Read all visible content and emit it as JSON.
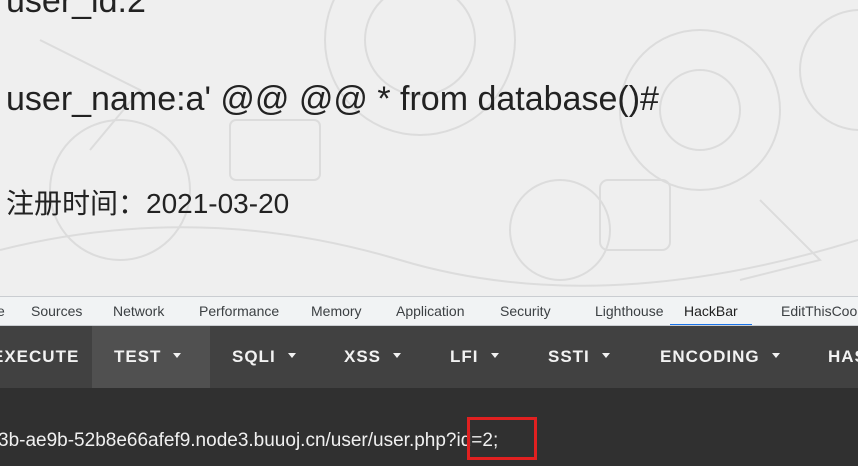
{
  "page": {
    "user_id_line": "user_id:2",
    "user_name_line": "user_name:a' @@ @@ * from database()#",
    "register_time_line": "注册时间：2021-03-20"
  },
  "devtools": {
    "tabs": [
      {
        "label": "e",
        "active": false
      },
      {
        "label": "Sources",
        "active": false
      },
      {
        "label": "Network",
        "active": false
      },
      {
        "label": "Performance",
        "active": false
      },
      {
        "label": "Memory",
        "active": false
      },
      {
        "label": "Application",
        "active": false
      },
      {
        "label": "Security",
        "active": false
      },
      {
        "label": "Lighthouse",
        "active": false
      },
      {
        "label": "HackBar",
        "active": true
      },
      {
        "label": "EditThisCookie",
        "active": false
      }
    ]
  },
  "hackbar": {
    "buttons": [
      {
        "label": "EXECUTE",
        "dropdown": false,
        "active": false
      },
      {
        "label": "TEST",
        "dropdown": true,
        "active": true
      },
      {
        "label": "SQLI",
        "dropdown": true,
        "active": false
      },
      {
        "label": "XSS",
        "dropdown": true,
        "active": false
      },
      {
        "label": "LFI",
        "dropdown": true,
        "active": false
      },
      {
        "label": "SSTI",
        "dropdown": true,
        "active": false
      },
      {
        "label": "ENCODING",
        "dropdown": true,
        "active": false
      },
      {
        "label": "HASHING",
        "dropdown": false,
        "active": false
      }
    ],
    "url_prefix": "3b-ae9b-52b8e66afef9.node3.buuoj.cn/user/user.php",
    "url_query": "?id=2;"
  },
  "colors": {
    "highlight_box": "#e02020",
    "active_tab_underline": "#1a73e8",
    "toolbar_bg": "#414141",
    "url_bg": "#303030"
  }
}
